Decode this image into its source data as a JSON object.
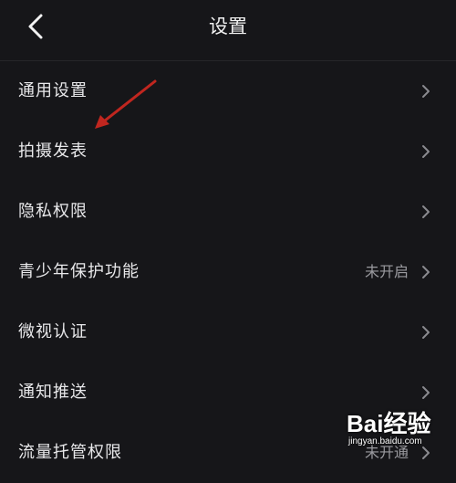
{
  "header": {
    "title": "设置"
  },
  "menu": [
    {
      "label": "通用设置",
      "value": ""
    },
    {
      "label": "拍摄发表",
      "value": ""
    },
    {
      "label": "隐私权限",
      "value": ""
    },
    {
      "label": "青少年保护功能",
      "value": "未开启"
    },
    {
      "label": "微视认证",
      "value": ""
    },
    {
      "label": "通知推送",
      "value": ""
    },
    {
      "label": "流量托管权限",
      "value": "未开通"
    }
  ],
  "watermark": {
    "logo": "Bai经验",
    "domain": "jingyan.baidu.com"
  },
  "colors": {
    "background": "#161619",
    "text": "#e8e8ea",
    "secondary": "#9a9a9f",
    "annotation": "#c0261f"
  },
  "icons": {
    "back": "chevron-left-icon",
    "row": "chevron-right-icon",
    "annotation": "red-arrow-annotation"
  }
}
